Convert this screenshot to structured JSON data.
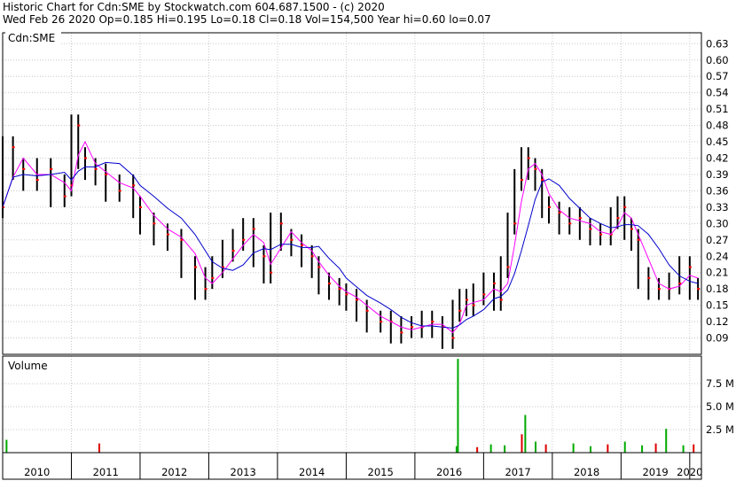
{
  "header": {
    "line1": "Historic Chart for Cdn:SME by Stockwatch.com 604.687.1500 - (c) 2020",
    "line2": "Wed Feb 26 2020   Op=0.185   Hi=0.195   Lo=0.18   Cl=0.18   Vol=154,500   Year hi=0.60   lo=0.07"
  },
  "price_panel": {
    "label": "Cdn:SME"
  },
  "volume_panel": {
    "label": "Volume"
  },
  "colors": {
    "price_bars": "#000000",
    "close_marks": "#ff0000",
    "ma_short": "#ff00ff",
    "ma_long": "#0000cc",
    "volume_up": "#00aa00",
    "volume_down": "#dd0000",
    "grid": "#c8c8c8"
  },
  "chart_data": [
    {
      "type": "ohlc",
      "ticker": "Cdn:SME",
      "y_ticks": [
        "0.63",
        "0.60",
        "0.57",
        "0.54",
        "0.51",
        "0.48",
        "0.45",
        "0.42",
        "0.39",
        "0.36",
        "0.33",
        "0.30",
        "0.27",
        "0.24",
        "0.21",
        "0.18",
        "0.15",
        "0.12",
        "0.09"
      ],
      "ylim": [
        0.06,
        0.65
      ],
      "x_ticks": [
        "2010",
        "2011",
        "2012",
        "2013",
        "2014",
        "2015",
        "2016",
        "2017",
        "2018",
        "2019",
        "2020"
      ],
      "xlim": [
        2010.0,
        2020.17
      ],
      "grid": true,
      "series": [
        {
          "name": "",
          "x": [
            2010.0,
            2010.15,
            2010.3,
            2010.5,
            2010.7,
            2010.9,
            2011.0,
            2011.1,
            2011.2,
            2011.35,
            2011.5,
            2011.7,
            2011.9,
            2012.0,
            2012.2,
            2012.4,
            2012.6,
            2012.8,
            2012.95,
            2013.05,
            2013.2,
            2013.35,
            2013.5,
            2013.65,
            2013.8,
            2013.9,
            2014.05,
            2014.2,
            2014.35,
            2014.5,
            2014.6,
            2014.75,
            2014.9,
            2015.0,
            2015.15,
            2015.3,
            2015.5,
            2015.65,
            2015.8,
            2015.95,
            2016.1,
            2016.25,
            2016.4,
            2016.55,
            2016.65,
            2016.75,
            2016.85,
            2017.0,
            2017.15,
            2017.25,
            2017.35,
            2017.45,
            2017.55,
            2017.65,
            2017.75,
            2017.85,
            2017.95,
            2018.1,
            2018.25,
            2018.4,
            2018.55,
            2018.7,
            2018.85,
            2018.95,
            2019.05,
            2019.15,
            2019.25,
            2019.4,
            2019.55,
            2019.7,
            2019.85,
            2020.0,
            2020.12
          ],
          "values": [
            0.33,
            0.44,
            0.4,
            0.38,
            0.4,
            0.35,
            0.37,
            0.48,
            0.42,
            0.4,
            0.39,
            0.36,
            0.37,
            0.33,
            0.3,
            0.28,
            0.27,
            0.22,
            0.18,
            0.2,
            0.22,
            0.25,
            0.27,
            0.29,
            0.24,
            0.21,
            0.3,
            0.27,
            0.26,
            0.24,
            0.22,
            0.19,
            0.18,
            0.17,
            0.16,
            0.14,
            0.12,
            0.12,
            0.1,
            0.11,
            0.11,
            0.12,
            0.11,
            0.09,
            0.14,
            0.16,
            0.15,
            0.17,
            0.19,
            0.16,
            0.22,
            0.3,
            0.38,
            0.42,
            0.4,
            0.38,
            0.33,
            0.32,
            0.3,
            0.31,
            0.29,
            0.28,
            0.28,
            0.31,
            0.33,
            0.29,
            0.27,
            0.2,
            0.18,
            0.18,
            0.19,
            0.22,
            0.18
          ]
        }
      ]
    },
    {
      "type": "bar",
      "title": "Volume",
      "y_ticks": [
        "7.5 M",
        "5.0 M",
        "2.5 M"
      ],
      "ylim": [
        0,
        10.5
      ],
      "x_ticks": [
        "2010",
        "2011",
        "2012",
        "2013",
        "2014",
        "2015",
        "2016",
        "2017",
        "2018",
        "2019",
        "2020"
      ],
      "series": [
        {
          "name": "",
          "x": [
            2010.05,
            2011.4,
            2016.6,
            2016.62,
            2016.9,
            2017.1,
            2017.3,
            2017.55,
            2017.6,
            2017.75,
            2017.9,
            2018.3,
            2018.55,
            2018.8,
            2019.05,
            2019.3,
            2019.5,
            2019.65,
            2019.9,
            2020.05
          ],
          "values": [
            1.4,
            1.0,
            0.7,
            10.2,
            0.6,
            0.9,
            0.8,
            2.0,
            4.1,
            1.2,
            0.9,
            1.0,
            0.7,
            0.9,
            1.2,
            0.8,
            1.0,
            2.6,
            0.8,
            0.9
          ]
        }
      ]
    }
  ]
}
